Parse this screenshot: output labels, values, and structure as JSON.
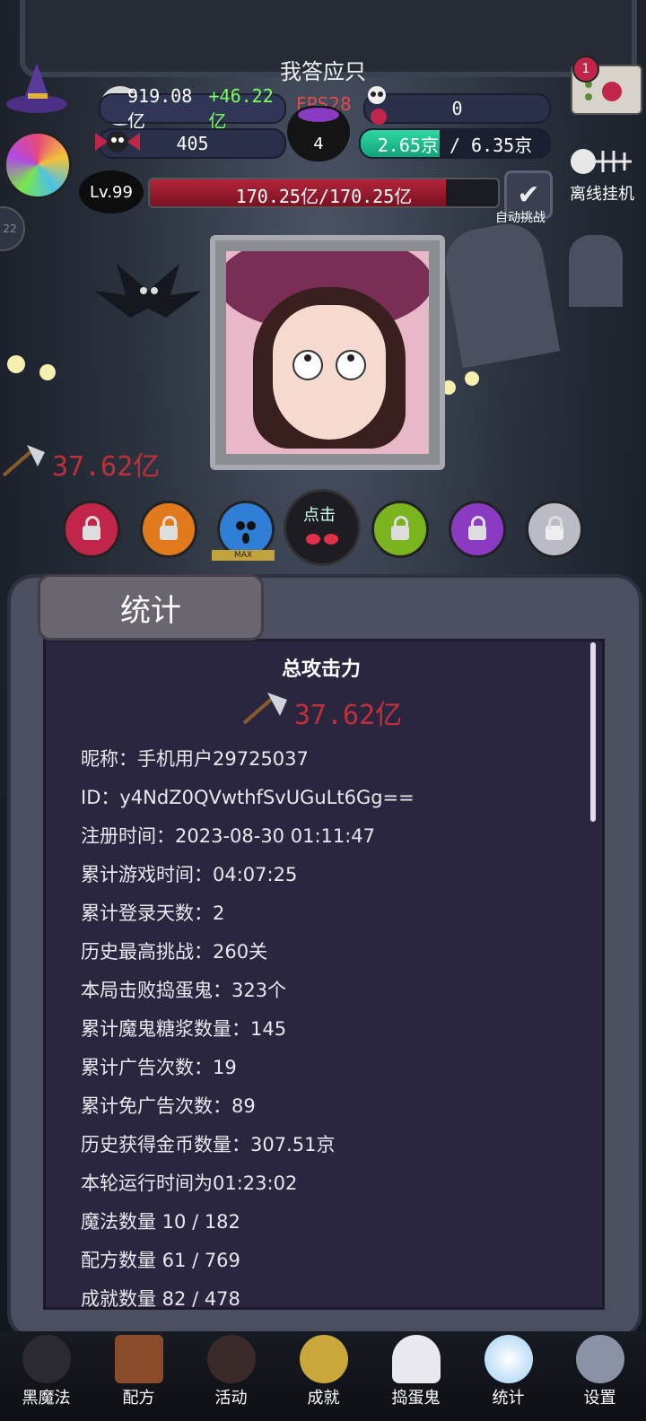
{
  "header": {
    "title": "我答应只",
    "gold": "919.08亿",
    "gold_gain": "+46.22亿",
    "fps": "FPS28",
    "skull_count": "0",
    "candy": "405",
    "cauldron_count": "4",
    "capacity": "2.65京 / 6.35京",
    "capacity_fraction": 0.42,
    "level": "Lv.99",
    "hp": "170.25亿/170.25亿",
    "hp_fraction": 0.85,
    "auto_challenge": "自动挑战",
    "offline_idle": "离线挂机",
    "mail_badge": "1",
    "side_badge": "22"
  },
  "battle": {
    "damage": "37.62亿",
    "click_label": "点击",
    "max_tag": "MAX",
    "orbs": [
      {
        "name": "red",
        "color": "#c2254a",
        "locked": true
      },
      {
        "name": "orange",
        "color": "#e07a1c",
        "locked": true
      },
      {
        "name": "blue",
        "color": "#2f7fd6",
        "locked": false
      },
      {
        "name": "green",
        "color": "#7ab51f",
        "locked": true
      },
      {
        "name": "purple",
        "color": "#8a3bc2",
        "locked": true
      },
      {
        "name": "grey",
        "color": "#b9bcc4",
        "locked": true
      }
    ]
  },
  "stats_panel": {
    "tab_label": "统计",
    "total_title": "总攻击力",
    "total_value": "37.62亿",
    "lines": [
      "昵称：手机用户29725037",
      "ID：y4NdZ0QVwthfSvUGuLt6Gg==",
      "注册时间：2023-08-30 01:11:47",
      "累计游戏时间：04:07:25",
      "累计登录天数：2",
      "历史最高挑战：260关",
      "本局击败捣蛋鬼：323个",
      "累计魔鬼糖浆数量：145",
      "累计广告次数：19",
      "累计免广告次数：89",
      "历史获得金币数量：307.51京",
      "本轮运行时间为01:23:02",
      "魔法数量 10 / 182",
      "配方数量 61 / 769",
      "成就数量 82 / 478"
    ]
  },
  "nav": [
    {
      "label": "黑魔法",
      "icon": "devil-icon",
      "color": "#2a2a30"
    },
    {
      "label": "配方",
      "icon": "book-icon",
      "color": "#8b4a2a"
    },
    {
      "label": "活动",
      "icon": "eyeballs-icon",
      "color": "#3a2a2a"
    },
    {
      "label": "成就",
      "icon": "skull-trophy-icon",
      "color": "#c9a73a"
    },
    {
      "label": "捣蛋鬼",
      "icon": "ghost-icon",
      "color": "#e8e8ee"
    },
    {
      "label": "统计",
      "icon": "crystal-ball-icon",
      "color": "#cfe6f7"
    },
    {
      "label": "设置",
      "icon": "gear-icon",
      "color": "#8a93a6"
    }
  ]
}
